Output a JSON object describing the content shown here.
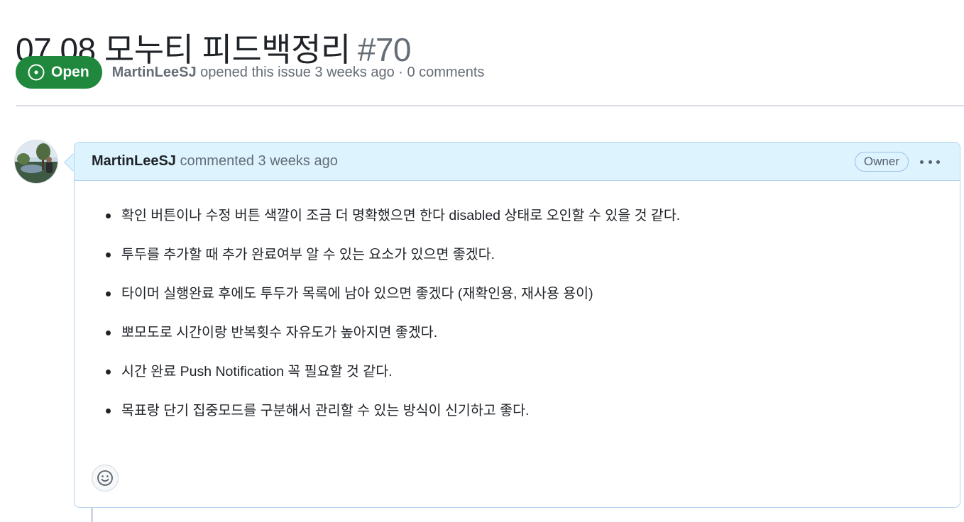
{
  "issue": {
    "title": "07.08 모누티 피드백정리",
    "number": "#70",
    "state": "Open",
    "author": "MartinLeeSJ",
    "meta": "opened this issue 3 weeks ago · 0 comments"
  },
  "comment": {
    "author": "MartinLeeSJ",
    "time": "commented 3 weeks ago",
    "role_badge": "Owner",
    "items": [
      "확인 버튼이나 수정 버튼 색깔이 조금 더 명확했으면 한다 disabled 상태로 오인할 수 있을 것 같다.",
      "투두를 추가할 때 추가 완료여부 알 수 있는 요소가 있으면 좋겠다.",
      "타이머 실행완료 후에도 투두가 목록에 남아 있으면 좋겠다 (재확인용, 재사용 용이)",
      "뽀모도로 시간이랑 반복횟수 자유도가 높아지면 좋겠다.",
      "시간 완료 Push Notification 꼭 필요할 것 같다.",
      "목표랑 단기 집중모드를 구분해서 관리할 수 있는 방식이 신기하고 좋다."
    ]
  },
  "icons": {
    "state": "issue-opened-icon",
    "menu": "kebab-horizontal-icon",
    "reaction": "smiley-icon"
  },
  "colors": {
    "open_green": "#1f883d",
    "header_blue": "#ddf4ff",
    "border_blue": "#b6d3ef",
    "muted": "#656d76"
  }
}
